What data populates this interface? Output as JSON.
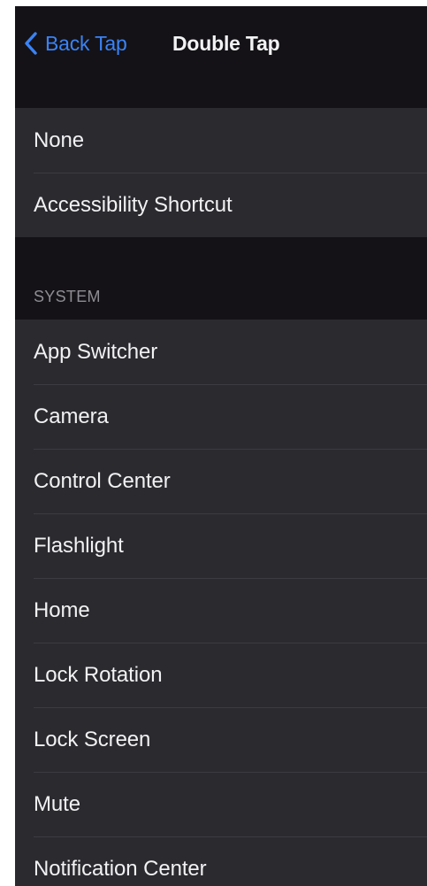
{
  "nav": {
    "back_label": "Back Tap",
    "title": "Double Tap"
  },
  "group1": {
    "items": [
      {
        "label": "None"
      },
      {
        "label": "Accessibility Shortcut"
      }
    ]
  },
  "system": {
    "header": "SYSTEM",
    "items": [
      {
        "label": "App Switcher"
      },
      {
        "label": "Camera"
      },
      {
        "label": "Control Center"
      },
      {
        "label": "Flashlight"
      },
      {
        "label": "Home"
      },
      {
        "label": "Lock Rotation"
      },
      {
        "label": "Lock Screen"
      },
      {
        "label": "Mute"
      },
      {
        "label": "Notification Center"
      }
    ]
  },
  "colors": {
    "accent": "#3a83f6",
    "background": "#141216",
    "cell": "#2b2a2f"
  }
}
